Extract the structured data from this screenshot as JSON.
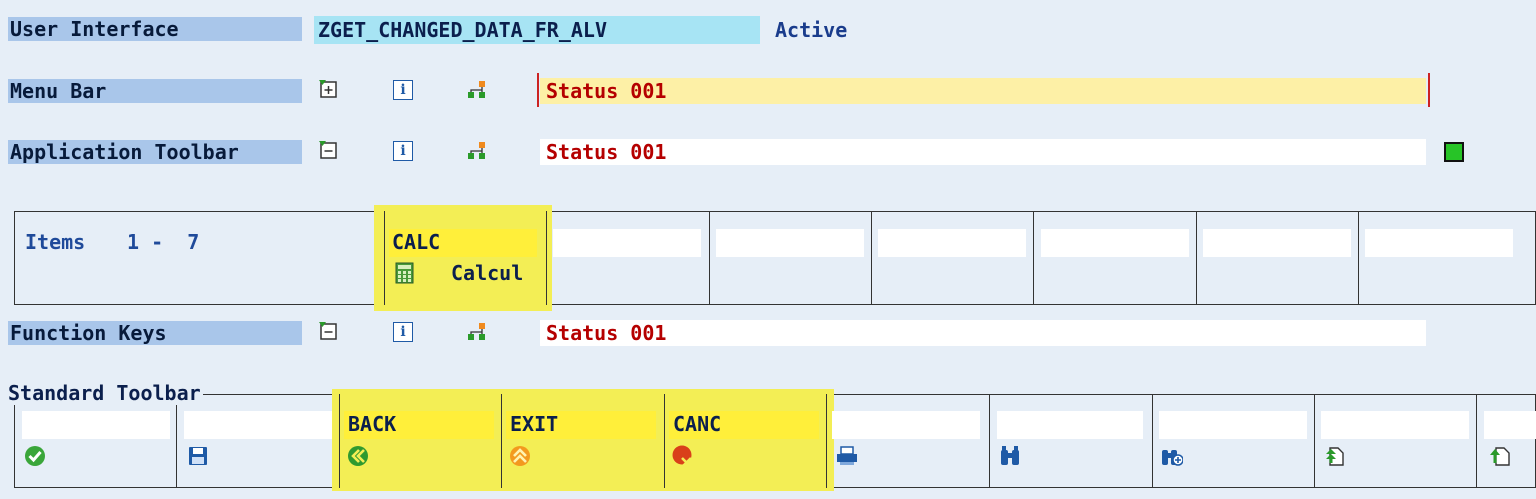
{
  "rows": {
    "user_interface": {
      "label": "User Interface",
      "name": "ZGET_CHANGED_DATA_FR_ALV",
      "status": "Active"
    },
    "menu_bar": {
      "label": "Menu Bar",
      "value": "Status 001"
    },
    "app_toolbar": {
      "label": "Application Toolbar",
      "value": "Status 001"
    },
    "function_keys": {
      "label": "Function Keys",
      "value": "Status 001"
    }
  },
  "items_panel": {
    "items_label": "Items",
    "range": "1 -  7",
    "calc_code": "CALC",
    "calc_text": "Calcul"
  },
  "standard_toolbar": {
    "label": "Standard Toolbar",
    "back": "BACK",
    "exit": "EXIT",
    "canc": "CANC"
  },
  "icons": [
    "expand-icon",
    "info-icon",
    "hierarchy-icon",
    "collapse-icon",
    "calculator-icon",
    "enter-icon",
    "save-icon",
    "back-icon",
    "exit-icon",
    "cancel-icon",
    "print-icon",
    "find-icon",
    "find-next-icon",
    "first-page-icon",
    "prev-page-icon"
  ],
  "colors": {
    "label_bg": "#a9c6ea",
    "highlight": "#f3ee55",
    "status_red": "#b50000",
    "active_green": "#27c427"
  }
}
